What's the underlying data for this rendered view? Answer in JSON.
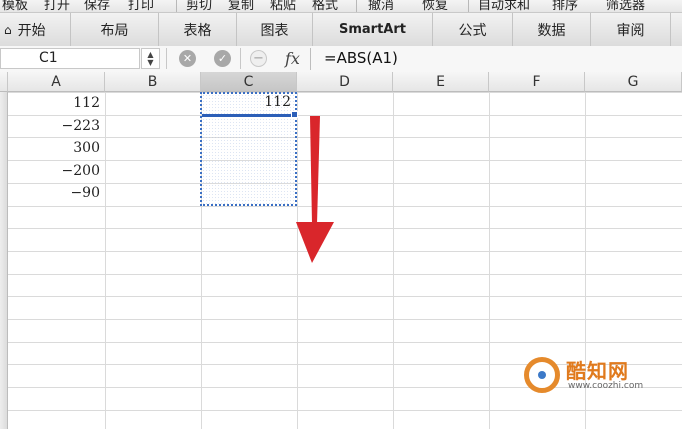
{
  "toolbar": {
    "items": [
      "模板",
      "打开",
      "保存",
      "打印",
      "剪切",
      "复制",
      "粘贴",
      "格式",
      "撤消",
      "恢复",
      "自动求和",
      "排序",
      "筛选器"
    ]
  },
  "ribbon": {
    "tabs": [
      "开始",
      "布局",
      "表格",
      "图表",
      "SmartArt",
      "公式",
      "数据",
      "审阅"
    ],
    "home_icon": "home-icon"
  },
  "formula_bar": {
    "name_box": "C1",
    "cancel_icon": "✕",
    "confirm_icon": "✓",
    "fx_label": "fx",
    "formula": "=ABS(A1)"
  },
  "sheet": {
    "columns": [
      "A",
      "B",
      "C",
      "D",
      "E",
      "F",
      "G"
    ],
    "selected_column": "C",
    "column_a_values": [
      "112",
      "−223",
      "300",
      "−200",
      "−90"
    ],
    "c1_value": "112"
  },
  "annotation": {
    "arrow_color": "#d9262b",
    "selection_color": "#2c5fb8"
  },
  "watermark": {
    "name": "酷知网",
    "url": "www.coozhi.com"
  }
}
